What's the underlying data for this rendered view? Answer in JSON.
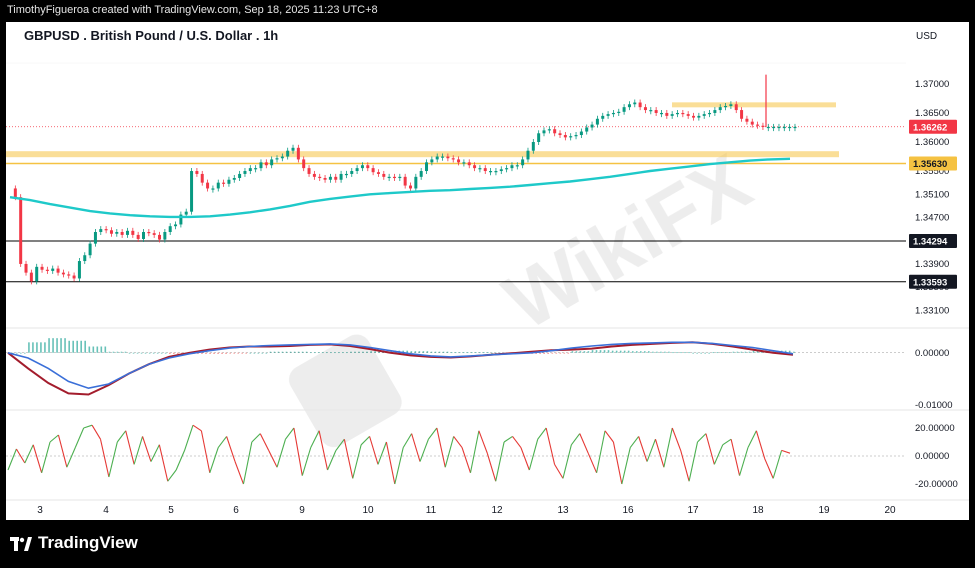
{
  "header": {
    "attribution": "TimothyFigueroa created with TradingView.com, Sep 18, 2025 11:23 UTC+8"
  },
  "footer": {
    "brand": "TradingView"
  },
  "watermark": {
    "text": "WikiFX"
  },
  "colors": {
    "price_line": "#1ec9c9",
    "support_band": "#f5c242",
    "current_price_badge": "#f23645",
    "up_candle": "#089981",
    "down_candle": "#f23645",
    "macd_line": "#3a6fd8",
    "signal_line": "#a31c2c",
    "rsi_up": "#4caf50",
    "rsi_down": "#e53935"
  },
  "chart_data": {
    "type": "line",
    "title": "GBPUSD . British Pound / U.S. Dollar . 1h",
    "currency": "USD",
    "x_tick_labels": [
      "3",
      "4",
      "5",
      "6",
      "9",
      "10",
      "11",
      "12",
      "13",
      "16",
      "17",
      "18",
      "19",
      "20"
    ],
    "price_axis": {
      "tick_labels": [
        "1.37000",
        "1.36500",
        "1.36000",
        "1.35500",
        "1.35100",
        "1.34700",
        "1.34300",
        "1.33900",
        "1.33500",
        "1.33100"
      ],
      "ylim": [
        1.329,
        1.3755
      ]
    },
    "price_badges": [
      {
        "label": "1.36262",
        "value": 1.36262,
        "style": "current"
      },
      {
        "label": "1.35630",
        "value": 1.3563,
        "style": "level"
      },
      {
        "label": "1.34294",
        "value": 1.34294,
        "style": "dark"
      },
      {
        "label": "1.33593",
        "value": 1.33593,
        "style": "dark"
      }
    ],
    "price_series": {
      "name": "",
      "x": [
        0,
        4,
        8,
        12,
        16,
        20,
        24,
        28,
        32,
        36,
        40,
        44,
        48,
        52,
        56,
        60,
        64,
        68,
        72,
        76,
        80,
        84,
        88,
        92,
        96,
        100,
        104,
        108,
        112,
        116,
        120,
        124,
        128,
        132,
        136,
        140,
        144,
        148,
        152,
        156,
        160,
        164,
        168,
        172,
        176,
        180,
        184,
        188,
        192,
        196,
        200,
        204,
        208,
        212,
        216,
        220,
        224,
        228,
        232,
        236,
        240,
        244,
        248,
        252,
        256,
        260,
        264,
        268,
        272,
        276,
        280,
        284,
        288,
        292,
        296,
        300,
        304,
        308,
        312,
        316,
        320,
        324,
        328,
        332,
        336,
        340,
        344,
        348,
        352,
        356,
        360,
        364,
        368,
        372,
        376,
        380,
        384,
        388,
        392,
        396,
        400,
        404,
        408,
        412,
        416,
        420,
        424,
        428,
        432,
        436,
        440,
        444,
        448,
        452,
        456,
        460,
        464,
        468,
        472,
        476,
        480,
        484,
        488,
        492,
        496,
        500,
        504,
        508,
        512,
        516,
        520,
        524,
        528,
        532,
        536,
        540,
        544,
        548,
        552,
        556,
        560,
        564,
        568,
        572,
        576,
        580,
        584,
        588
      ],
      "y": [
        1.352,
        1.3505,
        1.339,
        1.3375,
        1.336,
        1.3385,
        1.338,
        1.3378,
        1.3382,
        1.3375,
        1.3372,
        1.337,
        1.3365,
        1.3395,
        1.3405,
        1.3425,
        1.3445,
        1.345,
        1.3448,
        1.3442,
        1.3445,
        1.344,
        1.3447,
        1.344,
        1.3433,
        1.3445,
        1.3443,
        1.344,
        1.3432,
        1.3445,
        1.3455,
        1.3458,
        1.3475,
        1.348,
        1.355,
        1.3545,
        1.353,
        1.352,
        1.352,
        1.353,
        1.3528,
        1.3535,
        1.3538,
        1.3545,
        1.355,
        1.3555,
        1.3555,
        1.3565,
        1.356,
        1.357,
        1.3572,
        1.3575,
        1.3585,
        1.359,
        1.357,
        1.3555,
        1.3545,
        1.354,
        1.3538,
        1.3535,
        1.354,
        1.3535,
        1.3545,
        1.3545,
        1.355,
        1.3555,
        1.356,
        1.3555,
        1.3548,
        1.3545,
        1.354,
        1.354,
        1.3538,
        1.354,
        1.3525,
        1.352,
        1.354,
        1.355,
        1.3565,
        1.357,
        1.3575,
        1.3575,
        1.3572,
        1.357,
        1.3565,
        1.3565,
        1.356,
        1.3555,
        1.3555,
        1.355,
        1.355,
        1.355,
        1.3553,
        1.3555,
        1.356,
        1.356,
        1.357,
        1.3585,
        1.36,
        1.3615,
        1.362,
        1.3622,
        1.3615,
        1.3612,
        1.3608,
        1.361,
        1.3612,
        1.3618,
        1.3625,
        1.363,
        1.364,
        1.3645,
        1.3648,
        1.365,
        1.3652,
        1.366,
        1.3665,
        1.3668,
        1.366,
        1.3655,
        1.3655,
        1.365,
        1.365,
        1.3645,
        1.3648,
        1.365,
        1.3648,
        1.3645,
        1.3642,
        1.3645,
        1.3648,
        1.365,
        1.3655,
        1.366,
        1.3662,
        1.3665,
        1.3655,
        1.364,
        1.3635,
        1.363,
        1.3628,
        1.3626,
        1.3626,
        1.3626,
        1.3626,
        1.3626,
        1.3626,
        1.3626
      ]
    },
    "moving_average": {
      "name": "",
      "x": [
        0,
        20,
        40,
        60,
        80,
        100,
        120,
        140,
        160,
        180,
        200,
        220,
        240,
        260,
        280,
        300,
        320,
        340,
        360,
        380,
        400,
        420,
        440,
        460,
        480,
        500,
        520,
        540,
        560,
        580,
        600,
        620,
        640,
        660,
        680,
        700,
        720,
        740,
        760,
        780
      ],
      "y": [
        1.3505,
        1.35,
        1.3493,
        1.3487,
        1.3481,
        1.3477,
        1.3474,
        1.3472,
        1.3471,
        1.3471,
        1.3472,
        1.3475,
        1.3479,
        1.3484,
        1.349,
        1.3497,
        1.3502,
        1.3506,
        1.351,
        1.3512,
        1.3514,
        1.3516,
        1.3517,
        1.3519,
        1.3521,
        1.3523,
        1.3526,
        1.3529,
        1.3532,
        1.3536,
        1.354,
        1.3545,
        1.355,
        1.3554,
        1.3558,
        1.3562,
        1.3565,
        1.3568,
        1.357,
        1.3571
      ]
    },
    "levels": [
      {
        "value": 1.3579,
        "kind": "support-band",
        "x_start": 0,
        "x_end": 833
      },
      {
        "value": 1.3563,
        "kind": "level",
        "x_start": 0,
        "x_end": 900
      },
      {
        "value": 1.3664,
        "kind": "resistance-band",
        "x_start": 666,
        "x_end": 830
      },
      {
        "value": 1.34294,
        "kind": "black-line",
        "x_start": 0,
        "x_end": 900
      },
      {
        "value": 1.33593,
        "kind": "black-line",
        "x_start": 0,
        "x_end": 900
      }
    ],
    "spike": {
      "x": 760,
      "high": 1.3716,
      "low": 1.3626
    },
    "macd": {
      "tick_labels": [
        "0.00000",
        "-0.01000"
      ],
      "ylim": [
        -0.0106,
        0.0036
      ],
      "macd_line": [
        0.0,
        -0.001,
        -0.003,
        -0.0055,
        -0.0068,
        -0.006,
        -0.004,
        -0.0022,
        -0.001,
        -0.0002,
        0.0004,
        0.0009,
        0.0012,
        0.0014,
        0.0015,
        0.0016,
        0.0017,
        0.0015,
        0.001,
        0.0004,
        -0.0002,
        -0.0006,
        -0.0008,
        -0.0006,
        -0.0004,
        -0.0002,
        0.0,
        0.0004,
        0.0009,
        0.0013,
        0.0016,
        0.0018,
        0.0019,
        0.002,
        0.002,
        0.0018,
        0.0014,
        0.001,
        0.0004,
        -0.0002
      ],
      "signal_line": [
        0.0,
        -0.003,
        -0.0058,
        -0.0078,
        -0.008,
        -0.0062,
        -0.004,
        -0.0022,
        -0.0008,
        0.0,
        0.0006,
        0.001,
        0.0012,
        0.0012,
        0.0013,
        0.0015,
        0.0016,
        0.0013,
        0.0007,
        0.0,
        -0.0005,
        -0.0008,
        -0.0009,
        -0.0007,
        -0.0004,
        -0.0001,
        0.0002,
        0.0005,
        0.0006,
        0.0008,
        0.0012,
        0.0015,
        0.0017,
        0.0019,
        0.002,
        0.0017,
        0.0012,
        0.0006,
        0.0,
        -0.0004
      ]
    },
    "oscillator": {
      "tick_labels": [
        "20.00000",
        "0.00000",
        "-20.00000"
      ],
      "ylim": [
        -30,
        30
      ],
      "values": [
        -10,
        5,
        -5,
        8,
        -12,
        10,
        15,
        -8,
        6,
        20,
        22,
        12,
        -15,
        10,
        18,
        -6,
        14,
        -4,
        8,
        -18,
        -10,
        4,
        22,
        18,
        -12,
        6,
        14,
        -4,
        -20,
        10,
        16,
        4,
        -8,
        12,
        20,
        -14,
        6,
        18,
        -10,
        4,
        12,
        -16,
        8,
        14,
        -6,
        10,
        -20,
        6,
        16,
        -4,
        12,
        20,
        -8,
        14,
        6,
        -12,
        18,
        2,
        -18,
        10,
        14,
        6,
        -10,
        12,
        20,
        -6,
        -16,
        8,
        16,
        2,
        -12,
        18,
        10,
        -20,
        6,
        14,
        -4,
        12,
        -8,
        20,
        4,
        -18,
        10,
        16,
        -6,
        8,
        12,
        -14,
        6,
        18,
        -2,
        -16,
        4,
        2
      ]
    }
  }
}
